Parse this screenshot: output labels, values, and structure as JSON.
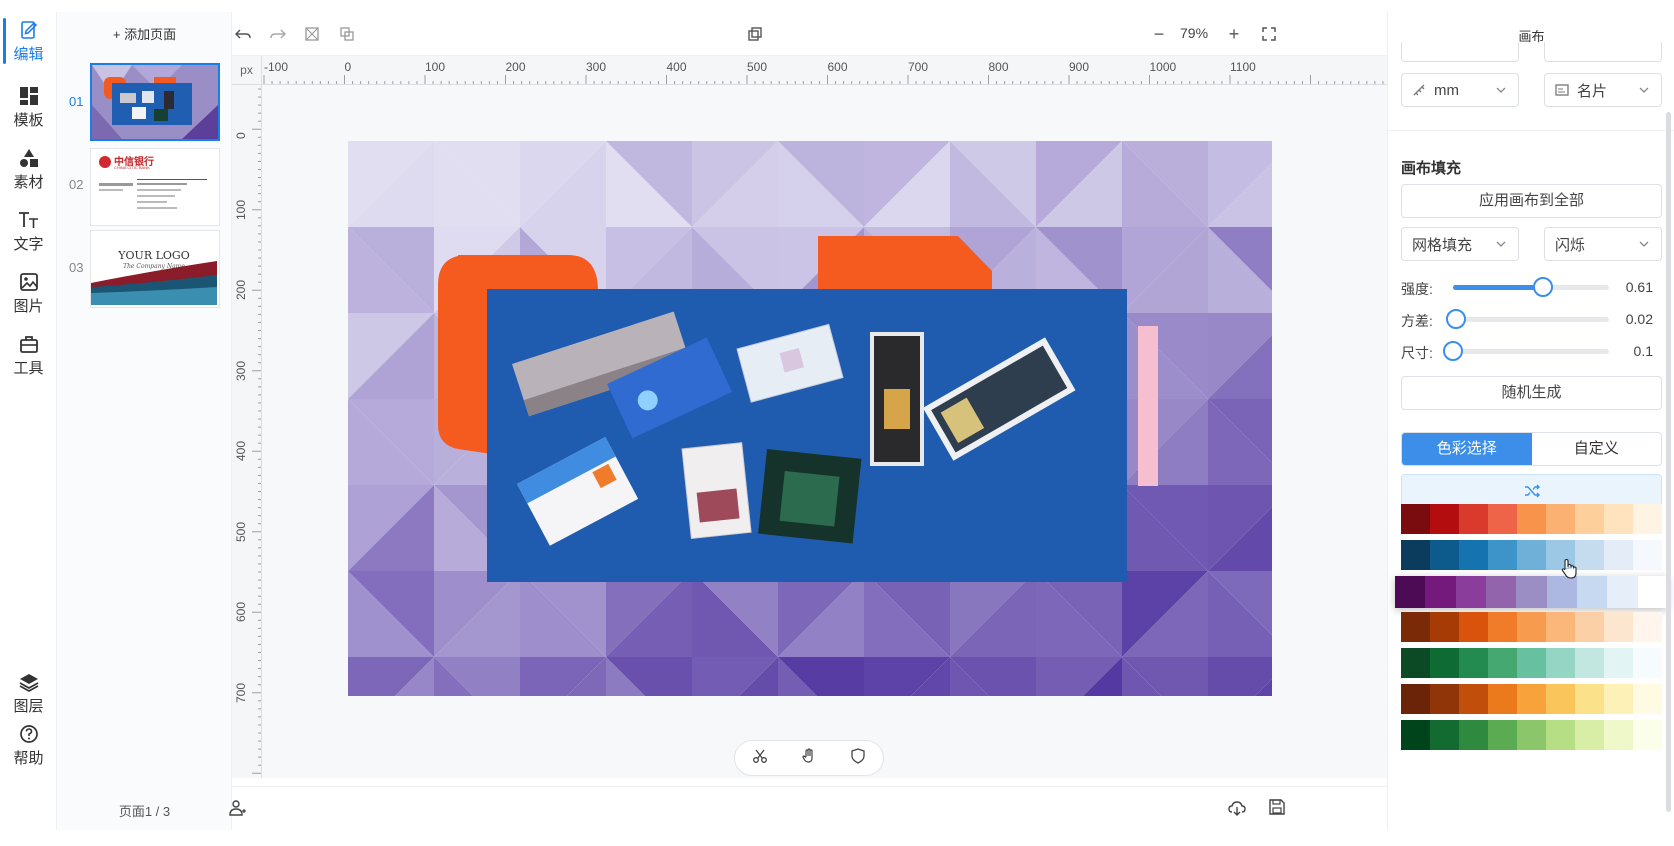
{
  "rail": {
    "items": [
      {
        "label": "编辑",
        "icon": "edit-icon",
        "active": true
      },
      {
        "label": "模板",
        "icon": "template-icon"
      },
      {
        "label": "素材",
        "icon": "shapes-icon"
      },
      {
        "label": "文字",
        "icon": "text-icon"
      },
      {
        "label": "图片",
        "icon": "image-icon"
      },
      {
        "label": "工具",
        "icon": "toolbox-icon"
      }
    ],
    "bottom": [
      {
        "label": "图层",
        "icon": "layers-icon"
      },
      {
        "label": "帮助",
        "icon": "help-icon"
      }
    ]
  },
  "pages": {
    "add_label": "+ 添加页面",
    "items": [
      {
        "num": "01"
      },
      {
        "num": "02",
        "bank_name": "中信银行",
        "bank_en": "CHINA CITIC BANK"
      },
      {
        "num": "03",
        "logo_text": "YOUR LOGO",
        "company": "The Company Name"
      }
    ],
    "indicator": "页面1 / 3"
  },
  "toolbar": {
    "zoom": "79%",
    "zoom_out": "−",
    "zoom_in": "+"
  },
  "ruler": {
    "unit": "px",
    "h_labels": [
      "-100",
      "0",
      "100",
      "200",
      "300",
      "400",
      "500",
      "600",
      "700",
      "800",
      "900",
      "1000",
      "1100"
    ],
    "v_labels": [
      "0",
      "100",
      "200",
      "300",
      "400",
      "500",
      "600",
      "700"
    ]
  },
  "right_panel": {
    "title": "画布",
    "unit_select": "mm",
    "size_select": "名片",
    "fill_section": "画布填充",
    "apply_all": "应用画布到全部",
    "fill_type": "网格填充",
    "effect": "闪烁",
    "sliders": [
      {
        "label": "强度:",
        "value": "0.61",
        "fraction": 0.58
      },
      {
        "label": "方差:",
        "value": "0.02",
        "fraction": 0.02
      },
      {
        "label": "尺寸:",
        "value": "0.1",
        "fraction": 0.0
      }
    ],
    "random_btn": "随机生成",
    "tabs": {
      "color": "色彩选择",
      "custom": "自定义"
    },
    "palettes": [
      [
        "#7a0b0e",
        "#b30d0f",
        "#d93a2c",
        "#ee6449",
        "#f7934a",
        "#fbb172",
        "#fdcf9a",
        "#fee3be",
        "#fff3e4"
      ],
      [
        "#0b3c5d",
        "#0d5a8c",
        "#1573b0",
        "#3d94c9",
        "#6fb0d9",
        "#9cc8e6",
        "#c5dcef",
        "#e4ecf7",
        "#f5f8fc"
      ],
      [
        "#4d0b55",
        "#741a7d",
        "#8a3d9a",
        "#9264ac",
        "#9b8ec5",
        "#adb8e2",
        "#c7d9f0",
        "#e6eefa",
        "#ffffff"
      ],
      [
        "#7a2a07",
        "#a63b06",
        "#d9530c",
        "#f07b28",
        "#f79b4f",
        "#fbb679",
        "#fcd0a6",
        "#fde6cf",
        "#fff5ec"
      ],
      [
        "#0b4a24",
        "#0e6b34",
        "#238b4f",
        "#45a870",
        "#67c1a0",
        "#94d6c3",
        "#c2e6e0",
        "#e3f4f5",
        "#f6fcfd"
      ],
      [
        "#6b2407",
        "#8f3507",
        "#c24e0b",
        "#ea7a1c",
        "#f7a23a",
        "#fac65b",
        "#fbe18a",
        "#fdf1b8",
        "#fffbe3"
      ],
      [
        "#00441b",
        "#146b32",
        "#2f8a3f",
        "#5aab52",
        "#8bc76a",
        "#b6de85",
        "#d8eea6",
        "#eef8c9",
        "#fbfee9"
      ]
    ]
  }
}
